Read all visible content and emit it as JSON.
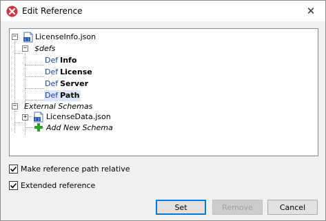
{
  "window": {
    "title": "Edit Reference",
    "close_glyph": "✕"
  },
  "tree": {
    "root_file": "LicenseInfo.json",
    "defs_label": "$defs",
    "def_prefix": "Def",
    "defs": [
      "Info",
      "License",
      "Server",
      "Path"
    ],
    "selected_def": "Path",
    "external_schemas_label": "External Schemas",
    "external_file": "LicenseData.json",
    "add_new_schema": "Add New Schema",
    "expander_open": "−",
    "expander_closed": "+"
  },
  "options": {
    "relative_path": {
      "label": "Make reference path relative",
      "checked": true
    },
    "extended_reference": {
      "label": "Extended reference",
      "checked": true
    }
  },
  "buttons": {
    "set": "Set",
    "remove": "Remove",
    "cancel": "Cancel"
  },
  "icons": {
    "app": "altova-x-icon",
    "json_file": "json-schema-file-icon",
    "add": "green-plus-icon",
    "check": "checkmark-icon"
  },
  "colors": {
    "selection": "#dde7f7",
    "def_prefix": "#1a3ea8",
    "default_button_border": "#0078d7",
    "add_icon": "#2aa02a",
    "app_icon": "#d3303a"
  }
}
